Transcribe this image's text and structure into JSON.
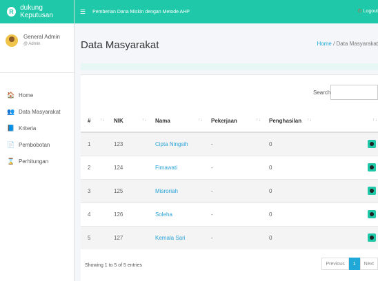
{
  "brand": {
    "name": "dukung Keputusan",
    "logo_letter": "R"
  },
  "user": {
    "name": "General Admin",
    "role": "@ Admin"
  },
  "nav": [
    {
      "label": "Home",
      "icon": "home-icon",
      "glyph": "🏠"
    },
    {
      "label": "Data Masyarakat",
      "icon": "users-icon",
      "glyph": "👥"
    },
    {
      "label": "Kriteria",
      "icon": "book-icon",
      "glyph": "📘"
    },
    {
      "label": "Pembobotan",
      "icon": "document-icon",
      "glyph": "📄"
    },
    {
      "label": "Perhitungan",
      "icon": "hourglass-icon",
      "glyph": "⌛"
    }
  ],
  "topbar": {
    "menu_glyph": "☰",
    "title": "Pemberian Dana Miskin dengan Metode AHP",
    "logout_label": "Logout"
  },
  "page": {
    "title": "Data Masyarakat",
    "breadcrumb_home": "Home",
    "breadcrumb_sep": " / ",
    "breadcrumb_current": "Data Masyarakat"
  },
  "search": {
    "label": "Search:",
    "value": ""
  },
  "table": {
    "headers": [
      "#",
      "NIK",
      "Nama",
      "Pekerjaan",
      "Penghasilan",
      ""
    ],
    "rows": [
      {
        "no": "1",
        "nik": "123",
        "nama": "Cipta Ningsih",
        "pekerjaan": "-",
        "penghasilan": "0"
      },
      {
        "no": "2",
        "nik": "124",
        "nama": "Fimawati",
        "pekerjaan": "-",
        "penghasilan": "0"
      },
      {
        "no": "3",
        "nik": "125",
        "nama": "Misroriah",
        "pekerjaan": "-",
        "penghasilan": "0"
      },
      {
        "no": "4",
        "nik": "126",
        "nama": "Soleha",
        "pekerjaan": "-",
        "penghasilan": "0"
      },
      {
        "no": "5",
        "nik": "127",
        "nama": "Kemala Sari",
        "pekerjaan": "-",
        "penghasilan": "0"
      }
    ]
  },
  "info": "Showing 1 to 5 of 5 entries",
  "pagination": {
    "previous": "Previous",
    "current": "1",
    "next": "Next"
  },
  "colors": {
    "accent": "#1fc8a8",
    "link": "#2aa3d8",
    "logout_icon": "#e74c3c"
  }
}
